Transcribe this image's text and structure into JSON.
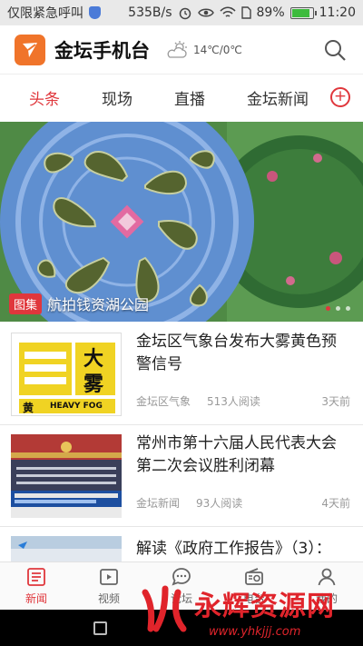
{
  "status_bar": {
    "carrier": "仅限紧急呼叫",
    "speed": "535B/s",
    "battery": "89%",
    "battery_level": 0.89,
    "time": "11:20"
  },
  "header": {
    "title": "金坛手机台",
    "weather": "14℃/0℃"
  },
  "tabs": [
    {
      "label": "头条",
      "active": true
    },
    {
      "label": "现场",
      "active": false
    },
    {
      "label": "直播",
      "active": false
    },
    {
      "label": "金坛新闻",
      "active": false
    }
  ],
  "hero": {
    "badge": "图集",
    "title": "航拍钱资湖公园"
  },
  "news": [
    {
      "headline": "金坛区气象台发布大雾黄色预警信号",
      "source": "金坛区气象",
      "reads": "513人阅读",
      "time": "3天前",
      "thumb_text": {
        "big1": "大",
        "big2": "雾",
        "small": "黄",
        "en": "HEAVY FOG"
      }
    },
    {
      "headline": "常州市第十六届人民代表大会第二次会议胜利闭幕",
      "source": "金坛新闻",
      "reads": "93人阅读",
      "time": "4天前"
    },
    {
      "headline": "解读《政府工作报告》（3）：",
      "source": "",
      "reads": "",
      "time": ""
    }
  ],
  "bottom_nav": [
    {
      "label": "新闻",
      "icon": "news-icon",
      "active": true
    },
    {
      "label": "视频",
      "icon": "video-icon",
      "active": false
    },
    {
      "label": "论坛",
      "icon": "chat-icon",
      "active": false
    },
    {
      "label": "电台",
      "icon": "radio-icon",
      "active": false
    },
    {
      "label": "我的",
      "icon": "user-icon",
      "active": false
    }
  ],
  "watermark": {
    "text": "永辉资源网",
    "url": "www.yhkjjj.com"
  },
  "colors": {
    "accent": "#e0373c",
    "logo": "#f0742a"
  }
}
